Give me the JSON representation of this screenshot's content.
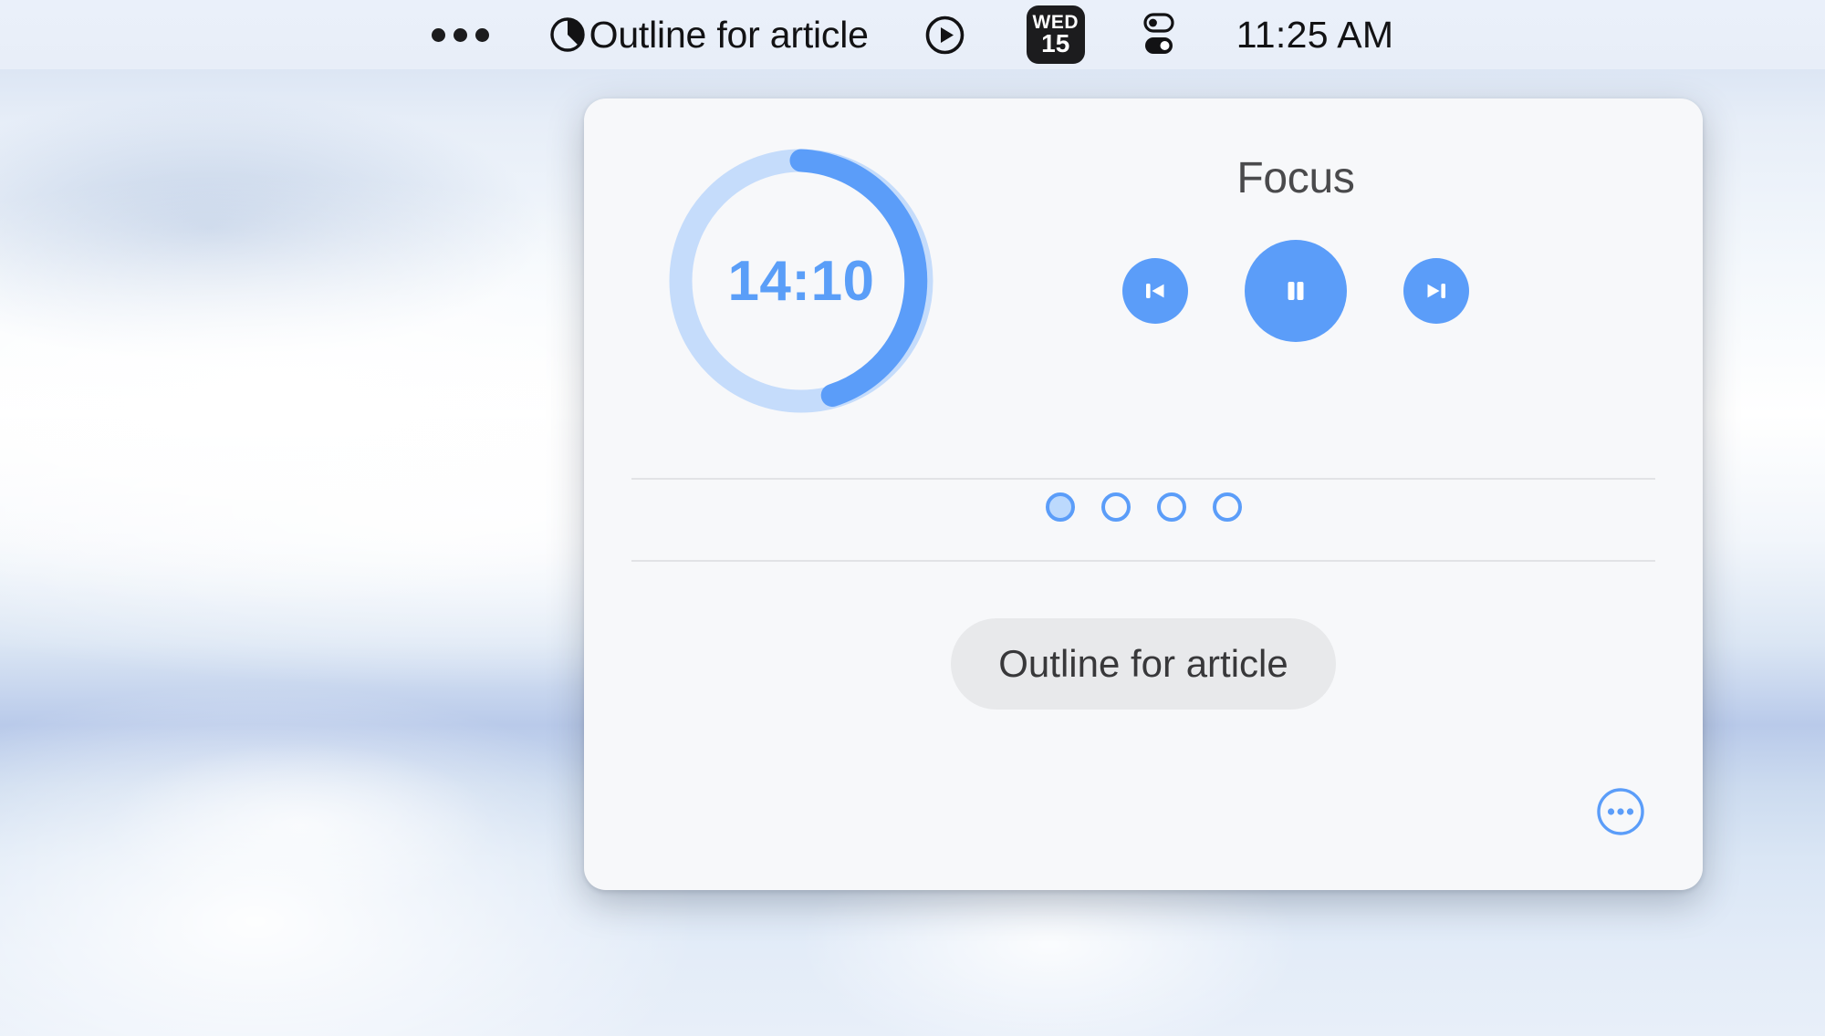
{
  "menubar": {
    "overflow_icon": "three-dots-icon",
    "timer_status_icon": "pie-timer-icon",
    "title": "Outline for article",
    "play_icon": "play-circle-icon",
    "calendar": {
      "icon": "calendar-icon",
      "weekday": "WED",
      "day": "15"
    },
    "control_center_icon": "control-center-toggles-icon",
    "clock": "11:25 AM"
  },
  "panel": {
    "timer": {
      "remaining": "14:10",
      "progress_percent": 46,
      "track_color": "#c5dcfb",
      "progress_color": "#5b9df9",
      "text_color": "#5a9ef8"
    },
    "mode_label": "Focus",
    "controls": {
      "previous": {
        "label": "Previous session",
        "icon": "skip-back-icon"
      },
      "pause": {
        "label": "Pause",
        "icon": "pause-icon"
      },
      "next": {
        "label": "Next session",
        "icon": "skip-forward-icon"
      }
    },
    "sessions": [
      {
        "state": "active"
      },
      {
        "state": "pending"
      },
      {
        "state": "pending"
      },
      {
        "state": "pending"
      }
    ],
    "task": "Outline for article",
    "more": {
      "label": "More options",
      "icon": "more-circle-icon"
    },
    "accent_color": "#5b9df9",
    "background_color": "#f7f8fa"
  }
}
